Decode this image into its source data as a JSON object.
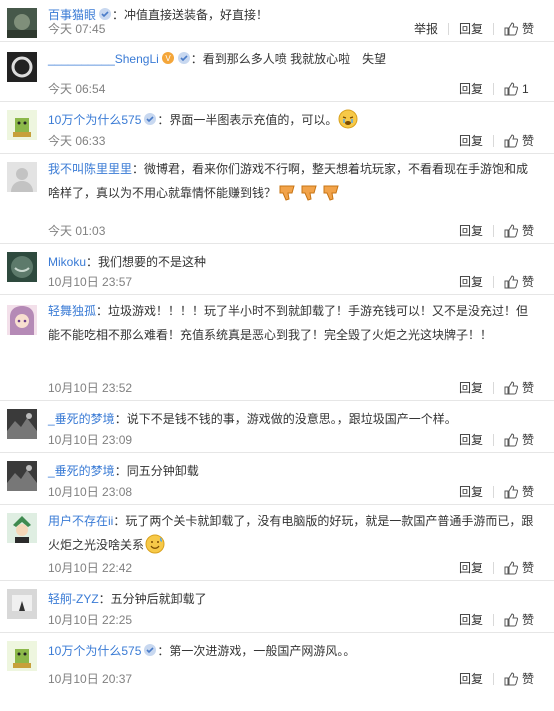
{
  "comments": [
    {
      "user": "百事猫眼",
      "text": "：冲值直接送装备，好直接！",
      "time": "今天 07:45",
      "report": "举报",
      "reply": "回复",
      "like": "赞",
      "h": 42,
      "avatar_color": "#445544",
      "name_color": "#3a7bd5"
    },
    {
      "user": "__________ShengLi",
      "text": "：看到那么多人喷 我就放心啦　失望",
      "time": "今天 06:54",
      "reply": "回复",
      "like": "1",
      "h": 60,
      "avatar_color": "#2a2a2a",
      "name_color": "#3a7bd5"
    },
    {
      "user": "10万个为什么575",
      "text": "：界面一半图表示充值的，可以。",
      "time": "今天 06:33",
      "reply": "回复",
      "like": "赞",
      "h": 52,
      "avatar_color": "#8cb84a",
      "name_color": "#3a7bd5"
    },
    {
      "user": "我不叫陈里里里",
      "text": "：微博君，看来你们游戏不行啊，整天想着坑玩家，不看看现在手游饱和成啥样了，真以为不用心就靠情怀能赚到钱？",
      "time": "今天 01:03",
      "reply": "回复",
      "like": "赞",
      "h": 90,
      "avatar_color": "#cfcfcf",
      "name_color": "#3a7bd5"
    },
    {
      "user": "Mikoku",
      "text": "：我们想要的不是这种",
      "time": "10月10日 23:57",
      "reply": "回复",
      "like": "赞",
      "h": 51,
      "avatar_color": "#3d5a4a",
      "name_color": "#3a7bd5"
    },
    {
      "user": "轻舞独孤",
      "text": "：垃圾游戏！！！！玩了半小时不到就卸载了！手游充钱可以！又不是没充过！但能不能吃相不那么难看！充值系统真是恶心到我了！完全毁了火炬之光这块牌子！！",
      "time": "10月10日 23:52",
      "reply": "回复",
      "like": "赞",
      "h": 106,
      "avatar_color": "#e8b9c8",
      "name_color": "#3a7bd5"
    },
    {
      "user": "_垂死的梦境",
      "text": "：说下不是钱不钱的事，游戏做的没意思。，跟垃圾国产一个样。",
      "time": "10月10日 23:09",
      "reply": "回复",
      "like": "赞",
      "h": 52,
      "avatar_color": "#555555",
      "name_color": "#3a7bd5"
    },
    {
      "user": "_垂死的梦境",
      "text": "：同五分钟卸载",
      "time": "10月10日 23:08",
      "reply": "回复",
      "like": "赞",
      "h": 52,
      "avatar_color": "#555555",
      "name_color": "#3a7bd5"
    },
    {
      "user": "用户不存在ii",
      "text": "：玩了两个关卡就卸载了，没有电脑版的好玩，就是一款国产普通手游而已，跟火炬之光没啥关系",
      "time": "10月10日 22:42",
      "reply": "回复",
      "like": "赞",
      "h": 76,
      "avatar_color": "#4f8a5f",
      "name_color": "#3a7bd5"
    },
    {
      "user": "轻舸-ZYZ",
      "text": "：五分钟后就卸载了",
      "time": "10月10日 22:25",
      "reply": "回复",
      "like": "赞",
      "h": 52,
      "avatar_color": "#bbbbbb",
      "name_color": "#3a7bd5"
    },
    {
      "user": "10万个为什么575",
      "text": "：第一次进游戏，一般国产网游风。。",
      "time": "10月10日 20:37",
      "reply": "回复",
      "like": "赞",
      "h": 58,
      "avatar_color": "#8cb84a",
      "name_color": "#3a7bd5"
    }
  ]
}
